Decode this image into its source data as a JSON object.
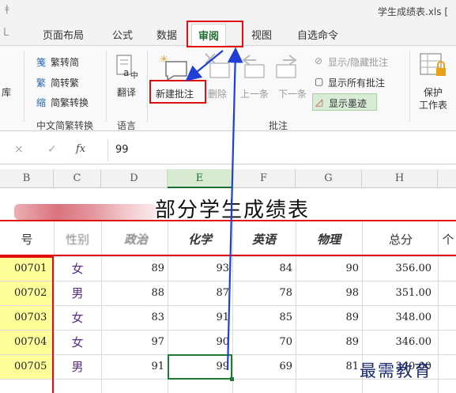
{
  "window": {
    "title": "学生成绩表.xls ["
  },
  "tabs": [
    {
      "label": "页面布局"
    },
    {
      "label": "公式"
    },
    {
      "label": "数据"
    },
    {
      "label": "审阅"
    },
    {
      "label": "视图"
    },
    {
      "label": "自选命令"
    }
  ],
  "ribbon": {
    "left_cut": "库",
    "chinese_convert": {
      "to_traditional": "繁转简",
      "to_simplified": "简转繁",
      "convert": "简繁转换",
      "group_label": "中文简繁转换"
    },
    "translate": {
      "label": "翻译",
      "group_label": "语言"
    },
    "comments": {
      "new_comment": "新建批注",
      "delete": "删除",
      "previous": "上一条",
      "next": "下一条",
      "show_hide": "显示/隐藏批注",
      "show_all": "显示所有批注",
      "show_ink": "显示墨迹",
      "group_label": "批注"
    },
    "protect": {
      "line1": "保护",
      "line2": "工作表"
    }
  },
  "formula_bar": {
    "cancel": "×",
    "confirm": "✓",
    "fx": "fx",
    "value": "99"
  },
  "columns": [
    "B",
    "C",
    "D",
    "E",
    "F",
    "G",
    "H"
  ],
  "selected_column": "E",
  "sheet": {
    "title": "部分学生成绩表",
    "headers": {
      "id": "号",
      "gender": "性别",
      "politics": "政治",
      "chemistry": "化学",
      "english": "英语",
      "physics": "物理",
      "total": "总分",
      "next": "个"
    },
    "rows": [
      {
        "id": "00701",
        "gender": "女",
        "politics": "89",
        "chemistry": "93",
        "english": "84",
        "physics": "90",
        "total": "356.00"
      },
      {
        "id": "00702",
        "gender": "男",
        "politics": "88",
        "chemistry": "87",
        "english": "78",
        "physics": "98",
        "total": "351.00"
      },
      {
        "id": "00703",
        "gender": "女",
        "politics": "83",
        "chemistry": "91",
        "english": "85",
        "physics": "89",
        "total": "348.00"
      },
      {
        "id": "00704",
        "gender": "女",
        "politics": "97",
        "chemistry": "90",
        "english": "70",
        "physics": "89",
        "total": "346.00"
      },
      {
        "id": "00705",
        "gender": "男",
        "politics": "91",
        "chemistry": "99",
        "english": "69",
        "physics": "81",
        "total": "340.00"
      }
    ]
  },
  "watermark": "最需教育",
  "colors": {
    "accent_green": "#1d6e30",
    "highlight_red": "#e01010",
    "arrow_blue": "#1f3fd6",
    "id_fill": "#ffff99"
  }
}
